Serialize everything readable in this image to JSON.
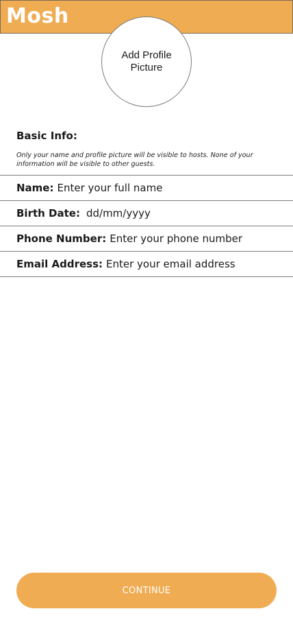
{
  "header": {
    "app_title": "Mosh",
    "bg_color": "#f0ac52"
  },
  "avatar": {
    "label": "Add Profile Picture"
  },
  "basic_info": {
    "heading": "Basic Info:",
    "note": "Only your name and profile picture will be visible to hosts. None of your information will be visible to other guests."
  },
  "fields": {
    "name": {
      "label": "Name:",
      "value": "",
      "placeholder": "Enter your full name"
    },
    "birth_date": {
      "label": "Birth Date:",
      "value": "",
      "placeholder": "dd/mm/yyyy"
    },
    "phone": {
      "label": "Phone Number:",
      "value": "",
      "placeholder": "Enter your phone number"
    },
    "email": {
      "label": "Email Address:",
      "value": "",
      "placeholder": "Enter your email address"
    }
  },
  "actions": {
    "continue_label": "CONTINUE",
    "accent_color": "#f0ac52"
  }
}
